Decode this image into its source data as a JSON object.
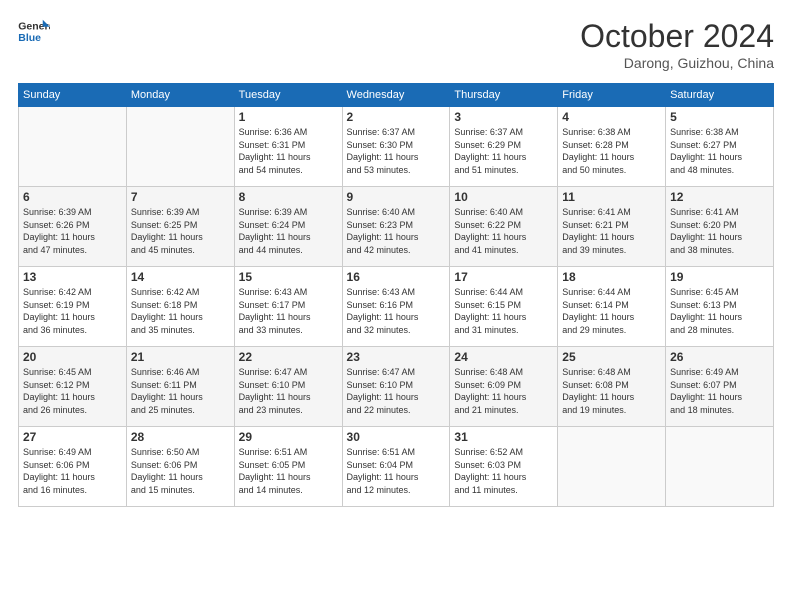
{
  "logo": {
    "line1": "General",
    "line2": "Blue"
  },
  "title": "October 2024",
  "location": "Darong, Guizhou, China",
  "days_of_week": [
    "Sunday",
    "Monday",
    "Tuesday",
    "Wednesday",
    "Thursday",
    "Friday",
    "Saturday"
  ],
  "weeks": [
    [
      {
        "day": "",
        "info": ""
      },
      {
        "day": "",
        "info": ""
      },
      {
        "day": "1",
        "info": "Sunrise: 6:36 AM\nSunset: 6:31 PM\nDaylight: 11 hours\nand 54 minutes."
      },
      {
        "day": "2",
        "info": "Sunrise: 6:37 AM\nSunset: 6:30 PM\nDaylight: 11 hours\nand 53 minutes."
      },
      {
        "day": "3",
        "info": "Sunrise: 6:37 AM\nSunset: 6:29 PM\nDaylight: 11 hours\nand 51 minutes."
      },
      {
        "day": "4",
        "info": "Sunrise: 6:38 AM\nSunset: 6:28 PM\nDaylight: 11 hours\nand 50 minutes."
      },
      {
        "day": "5",
        "info": "Sunrise: 6:38 AM\nSunset: 6:27 PM\nDaylight: 11 hours\nand 48 minutes."
      }
    ],
    [
      {
        "day": "6",
        "info": "Sunrise: 6:39 AM\nSunset: 6:26 PM\nDaylight: 11 hours\nand 47 minutes."
      },
      {
        "day": "7",
        "info": "Sunrise: 6:39 AM\nSunset: 6:25 PM\nDaylight: 11 hours\nand 45 minutes."
      },
      {
        "day": "8",
        "info": "Sunrise: 6:39 AM\nSunset: 6:24 PM\nDaylight: 11 hours\nand 44 minutes."
      },
      {
        "day": "9",
        "info": "Sunrise: 6:40 AM\nSunset: 6:23 PM\nDaylight: 11 hours\nand 42 minutes."
      },
      {
        "day": "10",
        "info": "Sunrise: 6:40 AM\nSunset: 6:22 PM\nDaylight: 11 hours\nand 41 minutes."
      },
      {
        "day": "11",
        "info": "Sunrise: 6:41 AM\nSunset: 6:21 PM\nDaylight: 11 hours\nand 39 minutes."
      },
      {
        "day": "12",
        "info": "Sunrise: 6:41 AM\nSunset: 6:20 PM\nDaylight: 11 hours\nand 38 minutes."
      }
    ],
    [
      {
        "day": "13",
        "info": "Sunrise: 6:42 AM\nSunset: 6:19 PM\nDaylight: 11 hours\nand 36 minutes."
      },
      {
        "day": "14",
        "info": "Sunrise: 6:42 AM\nSunset: 6:18 PM\nDaylight: 11 hours\nand 35 minutes."
      },
      {
        "day": "15",
        "info": "Sunrise: 6:43 AM\nSunset: 6:17 PM\nDaylight: 11 hours\nand 33 minutes."
      },
      {
        "day": "16",
        "info": "Sunrise: 6:43 AM\nSunset: 6:16 PM\nDaylight: 11 hours\nand 32 minutes."
      },
      {
        "day": "17",
        "info": "Sunrise: 6:44 AM\nSunset: 6:15 PM\nDaylight: 11 hours\nand 31 minutes."
      },
      {
        "day": "18",
        "info": "Sunrise: 6:44 AM\nSunset: 6:14 PM\nDaylight: 11 hours\nand 29 minutes."
      },
      {
        "day": "19",
        "info": "Sunrise: 6:45 AM\nSunset: 6:13 PM\nDaylight: 11 hours\nand 28 minutes."
      }
    ],
    [
      {
        "day": "20",
        "info": "Sunrise: 6:45 AM\nSunset: 6:12 PM\nDaylight: 11 hours\nand 26 minutes."
      },
      {
        "day": "21",
        "info": "Sunrise: 6:46 AM\nSunset: 6:11 PM\nDaylight: 11 hours\nand 25 minutes."
      },
      {
        "day": "22",
        "info": "Sunrise: 6:47 AM\nSunset: 6:10 PM\nDaylight: 11 hours\nand 23 minutes."
      },
      {
        "day": "23",
        "info": "Sunrise: 6:47 AM\nSunset: 6:10 PM\nDaylight: 11 hours\nand 22 minutes."
      },
      {
        "day": "24",
        "info": "Sunrise: 6:48 AM\nSunset: 6:09 PM\nDaylight: 11 hours\nand 21 minutes."
      },
      {
        "day": "25",
        "info": "Sunrise: 6:48 AM\nSunset: 6:08 PM\nDaylight: 11 hours\nand 19 minutes."
      },
      {
        "day": "26",
        "info": "Sunrise: 6:49 AM\nSunset: 6:07 PM\nDaylight: 11 hours\nand 18 minutes."
      }
    ],
    [
      {
        "day": "27",
        "info": "Sunrise: 6:49 AM\nSunset: 6:06 PM\nDaylight: 11 hours\nand 16 minutes."
      },
      {
        "day": "28",
        "info": "Sunrise: 6:50 AM\nSunset: 6:06 PM\nDaylight: 11 hours\nand 15 minutes."
      },
      {
        "day": "29",
        "info": "Sunrise: 6:51 AM\nSunset: 6:05 PM\nDaylight: 11 hours\nand 14 minutes."
      },
      {
        "day": "30",
        "info": "Sunrise: 6:51 AM\nSunset: 6:04 PM\nDaylight: 11 hours\nand 12 minutes."
      },
      {
        "day": "31",
        "info": "Sunrise: 6:52 AM\nSunset: 6:03 PM\nDaylight: 11 hours\nand 11 minutes."
      },
      {
        "day": "",
        "info": ""
      },
      {
        "day": "",
        "info": ""
      }
    ]
  ]
}
